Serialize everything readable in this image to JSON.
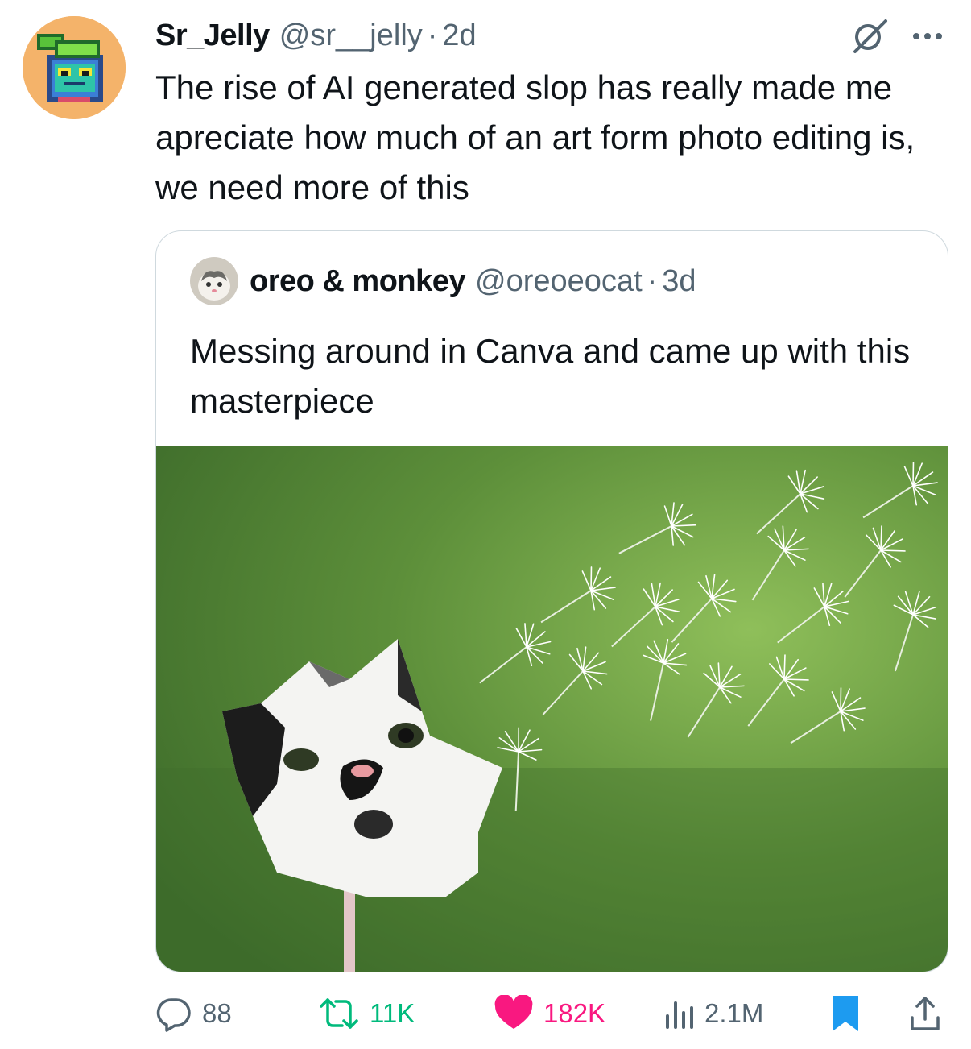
{
  "tweet": {
    "author_name": "Sr_Jelly",
    "handle": "@sr__jelly",
    "separator": "·",
    "age": "2d",
    "text": "The rise of AI generated slop has really made me apreciate how much of an art form photo editing is, we need more of this",
    "icons": {
      "grok": "grok-icon",
      "more": "more-icon"
    }
  },
  "quoted": {
    "author_name": "oreo & monkey",
    "handle": "@oreoeocat",
    "separator": "·",
    "age": "3d",
    "text": "Messing around in Canva and came up with this masterpiece",
    "media_description_icon": "photo"
  },
  "actions": {
    "replies": "88",
    "reposts": "11K",
    "likes": "182K",
    "views": "2.1M",
    "colors": {
      "repost": "#00ba7c",
      "like": "#f91880",
      "bookmark": "#1d9bf0",
      "gray": "#536471"
    }
  }
}
